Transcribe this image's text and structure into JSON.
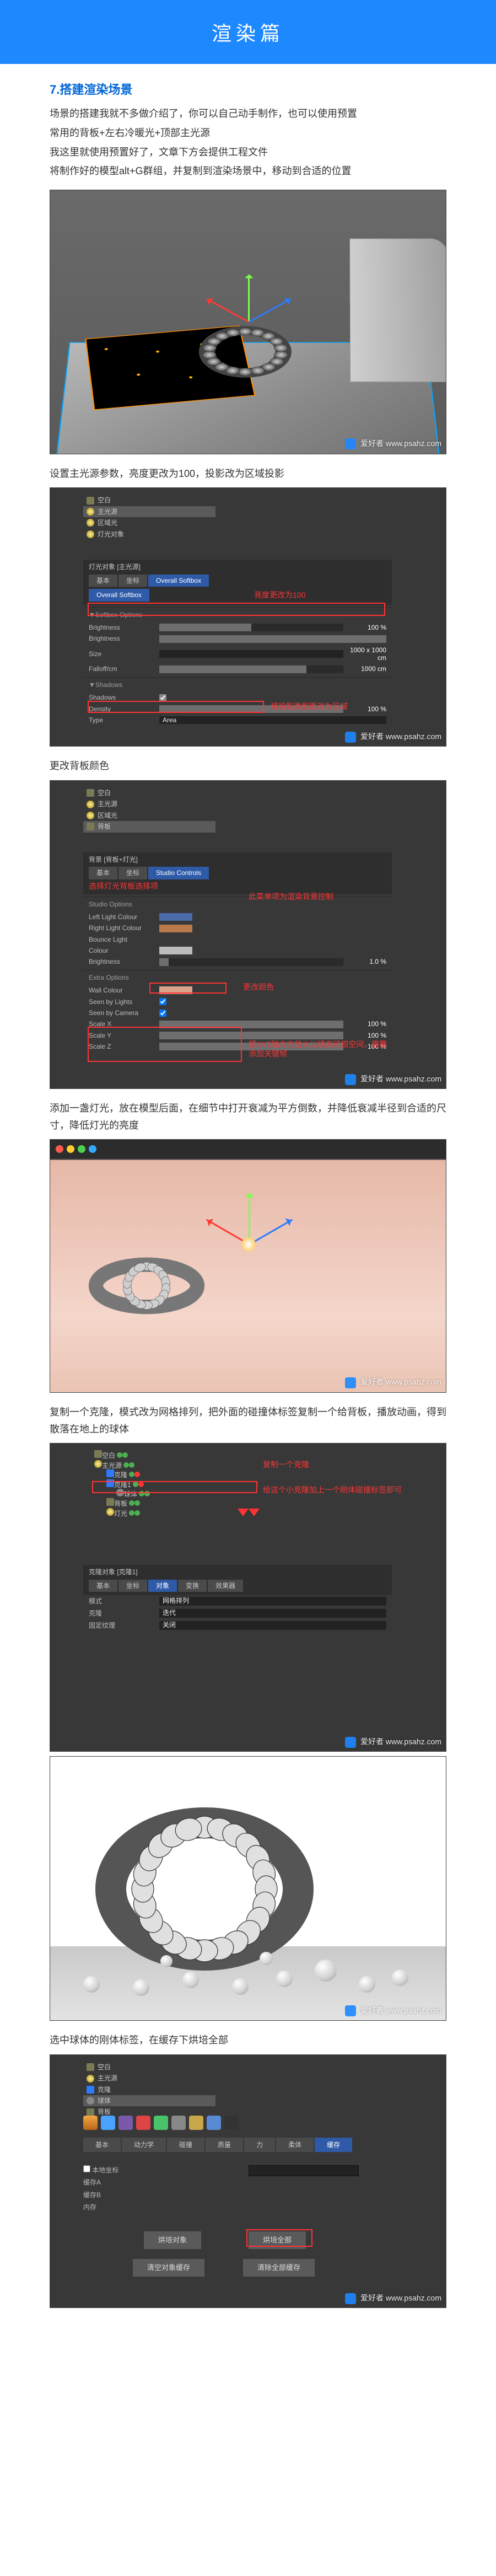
{
  "banner": {
    "title": "渲染篇"
  },
  "section": {
    "num": "7.",
    "title": "搭建渲染场景"
  },
  "intro": {
    "l1": "场景的搭建我就不多做介绍了，你可以自己动手制作，也可以使用预置",
    "l2": "常用的背板+左右冷暖光+顶部主光源",
    "l3": "我这里就使用预置好了，文章下方会提供工程文件",
    "l4": "将制作好的模型alt+G群组，并复制到渲染场景中，移动到合适的位置"
  },
  "cap1": "设置主光源参数，亮度更改为100，投影改为区域投影",
  "panel1": {
    "tree": [
      "空白",
      "主光源",
      "区域光",
      "灯光对象"
    ],
    "header": "灯光对象 [主光源]",
    "tab1": "基本",
    "tab2": "坐标",
    "soft": "Overall Softbox",
    "section1": "▼Softbox Options",
    "f_bright": "Brightness",
    "f_bright_v": "100 %",
    "f_size": "Size",
    "f_size_v": "1000 x 1000 cm",
    "section2": "▼Shadows",
    "f_shadows": "Shadows",
    "f_density": "Density",
    "f_density_v": "100 %",
    "f_type": "Type",
    "f_type_v": "Area",
    "annot": "将投影类型更改为区域"
  },
  "cap2": "更改背板颜色",
  "panel2": {
    "tree": [
      "空白",
      "主光源",
      "区域光",
      "背板"
    ],
    "header": "背景 [背板+灯光]",
    "tab_active": "Studio Controls",
    "section1": "Studio Options",
    "annot_top": "选择灯光背板选择项",
    "annot_top2": "此菜单项为渲染背景控制",
    "f_ll": "Left Light Colour",
    "f_rl": "Right Light Colour",
    "f_bl": "Bounce Light",
    "f_col": "Colour",
    "f_bri": "Brightness",
    "f_bri_v": "1.0 %",
    "section2": "Extra Options",
    "f_wc": "Wall Colour",
    "f_sbl": "Seen by Lights",
    "f_sbc": "Seen by Camera",
    "f_sx": "Scale X",
    "v100": "100 %",
    "f_sy": "Scale Y",
    "f_sz": "Scale Z",
    "annot_color": "更改颜色",
    "annot_bottom": "把XYZ轴方向放大以填充可视空间，需要添加关键帧"
  },
  "cap3": "添加一盏灯光，放在模型后面，在细节中打开衰减为平方倒数，并降低衰减半径到合适的尺寸，降低灯光的亮度",
  "cap4": "复制一个克隆，模式改为网格排列，把外面的碰撞体标签复制一个给背板，播放动画，得到散落在地上的球体",
  "panel4": {
    "tree": [
      "空白",
      "主光源",
      "克隆",
      "克隆1",
      "球体",
      "背板",
      "灯光"
    ],
    "annot1": "复制一个克隆",
    "annot2": "给这个小克隆加上一个刚体碰撞标签即可",
    "header": "克隆对象 [克隆1]",
    "tabs": [
      "基本",
      "坐标",
      "对象",
      "变换",
      "效果器"
    ],
    "f_mode": "模式",
    "f_mode_v": "网格排列",
    "f_clone": "克隆",
    "f_clone_v": "迭代",
    "f_fix": "固定纹理",
    "f_fix_v": "关闭"
  },
  "cap5": "选中球体的刚体标签，在缓存下烘培全部",
  "panel5": {
    "tree": [
      "空白",
      "主光源",
      "克隆",
      "球体",
      "背板"
    ],
    "iconbar_count": 9,
    "tabs": [
      "基本",
      "动力学",
      "碰撞",
      "质量",
      "力",
      "柔体",
      "缓存"
    ],
    "tab_active": "缓存",
    "f_local": "本地坐标",
    "f_cacheA": "缓存A",
    "f_cacheB": "缓存B",
    "f_mem": "内存",
    "btn_bake": "烘培对象",
    "btn_bake_all": "烘培全部",
    "btn_clear": "清空对象缓存",
    "btn_clear_all": "清除全部缓存"
  },
  "watermark": {
    "brand": "爱好者",
    "site": "www.psahz.com"
  }
}
